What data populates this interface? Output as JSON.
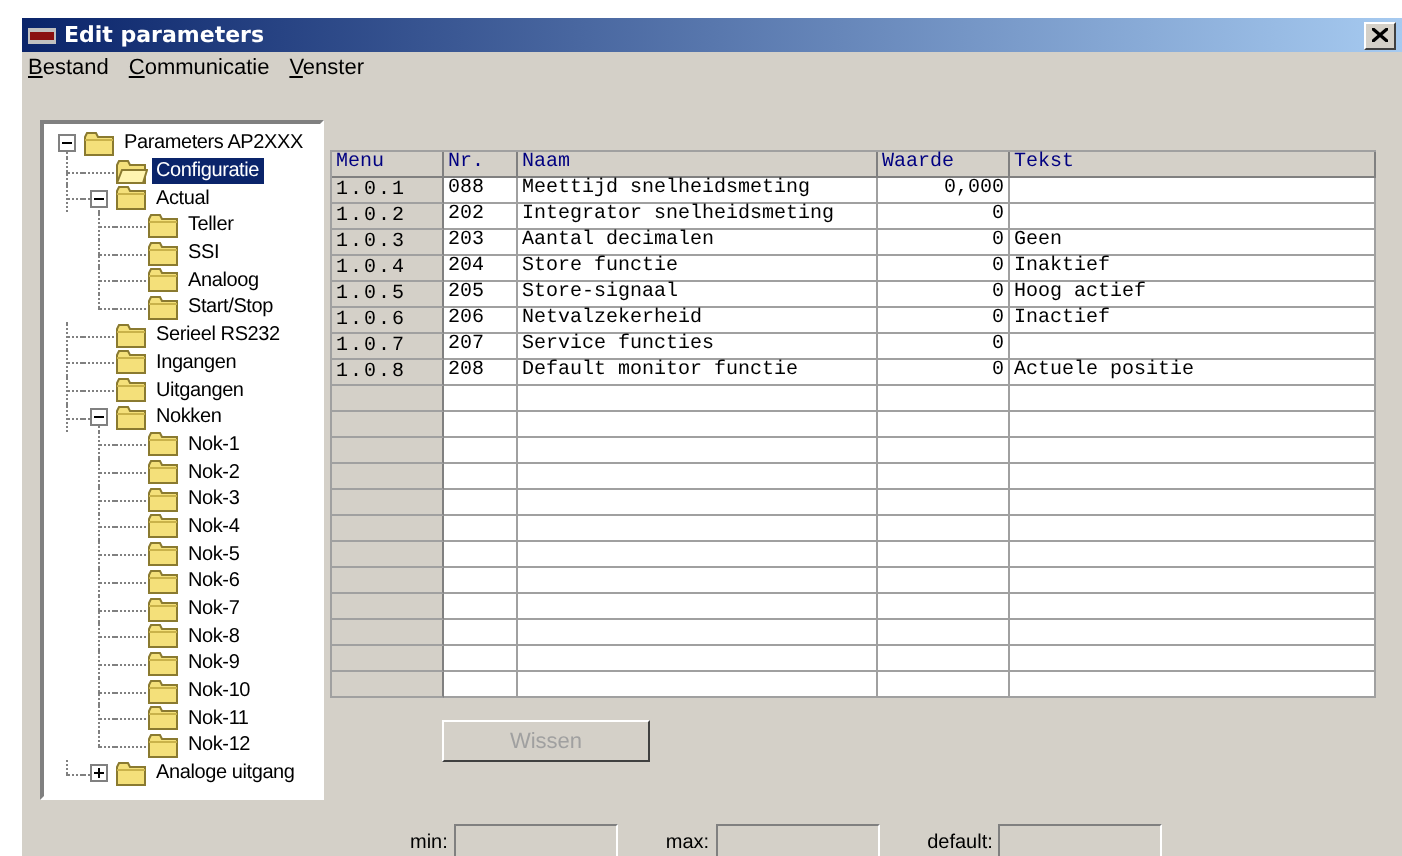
{
  "window": {
    "title": "Edit parameters"
  },
  "menu": [
    {
      "key": "B",
      "rest": "estand"
    },
    {
      "key": "C",
      "rest": "ommunicatie"
    },
    {
      "key": "V",
      "rest": "enster"
    }
  ],
  "tree": [
    {
      "label": "Parameters AP2XXX",
      "selected": false,
      "expanded": true,
      "children": [
        {
          "label": "Configuratie",
          "selected": true
        },
        {
          "label": "Actual",
          "selected": false,
          "expanded": true,
          "children": [
            {
              "label": "Teller",
              "selected": false
            },
            {
              "label": "SSI",
              "selected": false
            },
            {
              "label": "Analoog",
              "selected": false
            },
            {
              "label": "Start/Stop",
              "selected": false
            }
          ]
        },
        {
          "label": "Serieel RS232",
          "selected": false
        },
        {
          "label": "Ingangen",
          "selected": false
        },
        {
          "label": "Uitgangen",
          "selected": false
        },
        {
          "label": "Nokken",
          "selected": false,
          "expanded": true,
          "children": [
            {
              "label": "Nok-1",
              "selected": false
            },
            {
              "label": "Nok-2",
              "selected": false
            },
            {
              "label": "Nok-3",
              "selected": false
            },
            {
              "label": "Nok-4",
              "selected": false
            },
            {
              "label": "Nok-5",
              "selected": false
            },
            {
              "label": "Nok-6",
              "selected": false
            },
            {
              "label": "Nok-7",
              "selected": false
            },
            {
              "label": "Nok-8",
              "selected": false
            },
            {
              "label": "Nok-9",
              "selected": false
            },
            {
              "label": "Nok-10",
              "selected": false
            },
            {
              "label": "Nok-11",
              "selected": false
            },
            {
              "label": "Nok-12",
              "selected": false
            }
          ]
        },
        {
          "label": "Analoge uitgang",
          "selected": false,
          "expanded": false
        }
      ]
    }
  ],
  "table": {
    "columns": [
      "Menu",
      "Nr.",
      "Naam",
      "Waarde",
      "Tekst"
    ],
    "rows": [
      {
        "menu": "1.0.1",
        "nr": "088",
        "naam": "Meettijd snelheidsmeting",
        "waarde": "0,000",
        "tekst": ""
      },
      {
        "menu": "1.0.2",
        "nr": "202",
        "naam": "Integrator snelheidsmeting",
        "waarde": "0",
        "tekst": ""
      },
      {
        "menu": "1.0.3",
        "nr": "203",
        "naam": "Aantal decimalen",
        "waarde": "0",
        "tekst": "Geen"
      },
      {
        "menu": "1.0.4",
        "nr": "204",
        "naam": "Store functie",
        "waarde": "0",
        "tekst": "Inaktief"
      },
      {
        "menu": "1.0.5",
        "nr": "205",
        "naam": "Store-signaal",
        "waarde": "0",
        "tekst": "Hoog actief"
      },
      {
        "menu": "1.0.6",
        "nr": "206",
        "naam": "Netvalzekerheid",
        "waarde": "0",
        "tekst": "Inactief"
      },
      {
        "menu": "1.0.7",
        "nr": "207",
        "naam": "Service functies",
        "waarde": "0",
        "tekst": ""
      },
      {
        "menu": "1.0.8",
        "nr": "208",
        "naam": "Default monitor functie",
        "waarde": "0",
        "tekst": "Actuele positie"
      }
    ]
  },
  "clear_button": {
    "label": "Wissen",
    "disabled": true
  },
  "fields": [
    {
      "label": "min:"
    },
    {
      "label": "max:"
    },
    {
      "label": "default:"
    }
  ]
}
